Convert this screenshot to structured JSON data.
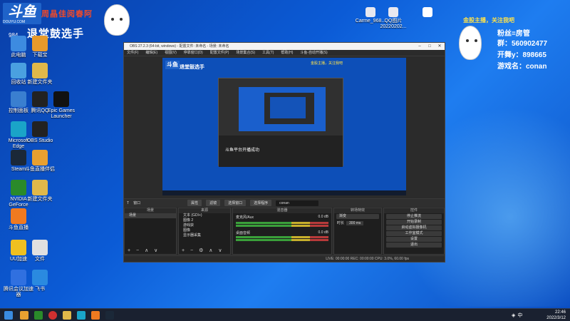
{
  "overlay_top_left": {
    "logo": "斗鱼",
    "logo_sub": "DOUYU.COM",
    "slogan": "周晶佳阅春阿",
    "room_id": "984",
    "streamer_name": "退堂鼓选手"
  },
  "overlay_top_right": {
    "attention": "金股主播，关注我吧",
    "fan_label": "粉丝=房管",
    "group_line": "群：560902477",
    "open_line": "开舞y：898665",
    "game_line": "游戏名：conan"
  },
  "desktop": {
    "top_icons": [
      {
        "label": "Carme_968..."
      },
      {
        "label": "QQ图片20220202..."
      },
      {
        "label": ""
      }
    ],
    "left_icons": [
      {
        "label": "此电脑",
        "color": "#3d8be0"
      },
      {
        "label": "下载宝",
        "color": "#e89a2a"
      },
      {
        "label": "回收站",
        "color": "#4aa0e0"
      },
      {
        "label": "新建文件夹",
        "color": "#e0b84a"
      },
      {
        "label": "控制面板",
        "color": "#3a7fd0"
      },
      {
        "label": "腾讯QQ",
        "color": "#222"
      },
      {
        "label": "Epic Games Launcher",
        "color": "#111"
      },
      {
        "label": "Microsoft Edge",
        "color": "#1aa4c8"
      },
      {
        "label": "OBS Studio",
        "color": "#222"
      },
      {
        "label": "Steam",
        "color": "#1b2838"
      },
      {
        "label": "斗鱼直播伴侣",
        "color": "#e8a030"
      },
      {
        "label": "NVIDIA GeForce",
        "color": "#2a8a2a"
      },
      {
        "label": "新建文件夹",
        "color": "#e0b84a"
      },
      {
        "label": "斗鱼直播",
        "color": "#f07a20"
      },
      {
        "label": "UU加速",
        "color": "#f0c020"
      },
      {
        "label": "文件",
        "color": "#e0e0e0"
      },
      {
        "label": "腾讯会议加速器",
        "color": "#3070e0"
      },
      {
        "label": "飞书",
        "color": "#2a8ae0"
      }
    ]
  },
  "obs": {
    "title": "OBS 27.2.3 (64-bit, windows) - 配置文件: 未命名 - 场景: 未命名",
    "menu": [
      "文件(F)",
      "编辑(E)",
      "视图(V)",
      "停靠窗口(D)",
      "配置文件(P)",
      "场景集合(S)",
      "工具(T)",
      "帮助(H)",
      "斗鱼-自动开播(S)"
    ],
    "preview_toast": "斗鱼平台开播成功",
    "toolbar": {
      "source_label": "窗口",
      "properties": "属性",
      "filters": "滤镜",
      "select_window": "选择窗口",
      "select_program": "选择程序",
      "value": "conan"
    },
    "scenes": {
      "header": "场景",
      "items": [
        "场景"
      ]
    },
    "sources": {
      "header": "来源",
      "items": [
        "文本 (GDI+)",
        "图像 2",
        "游戏获",
        "图像",
        "显示器采集"
      ]
    },
    "mixer": {
      "header": "混音器",
      "channels": [
        {
          "name": "麦克风/Aux",
          "db": "0.0 dB"
        },
        {
          "name": "桌面音频",
          "db": "0.0 dB"
        }
      ]
    },
    "transitions": {
      "header": "转场特效",
      "type": "渐变",
      "duration_label": "时长",
      "duration": "300 ms"
    },
    "controls": {
      "header": "控件",
      "buttons": [
        "停止推流",
        "开始录制",
        "启动虚拟摄像机",
        "工作室模式",
        "设置",
        "退出"
      ]
    },
    "status": "LIVE: 00:00:00   REC: 00:00:00   CPU: 3.0%, 60.00 fps"
  },
  "taskbar": {
    "time": "22:46",
    "date": "2022/3/12",
    "ime": "中"
  }
}
